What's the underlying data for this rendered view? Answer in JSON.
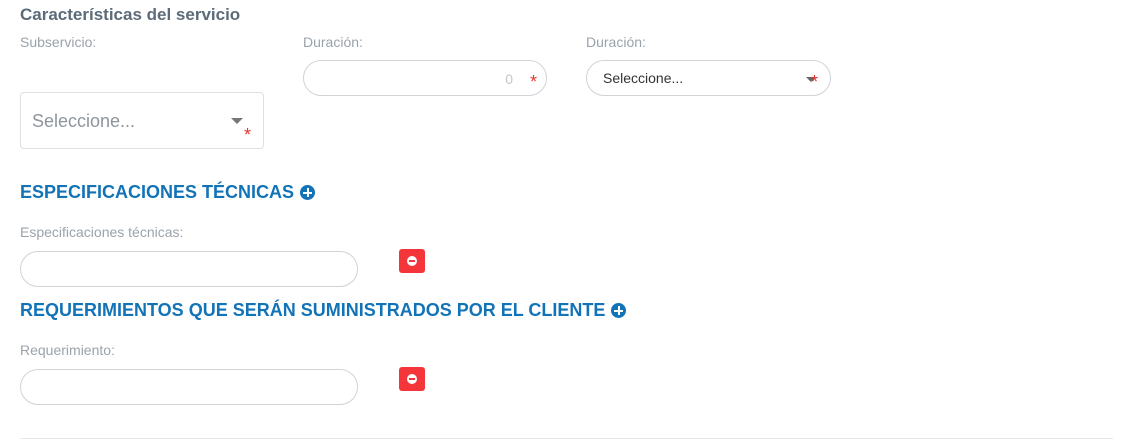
{
  "service": {
    "title": "Características del servicio",
    "subservicio_label": "Subservicio:",
    "subservicio_value": "Seleccione...",
    "duracion_label": "Duración:",
    "duracion_value": "0",
    "duracion_unit_label": "Duración:",
    "duracion_unit_value": "Seleccione...",
    "required_mark": "*"
  },
  "specs": {
    "heading": "ESPECIFICACIONES TÉCNICAS",
    "field_label": "Especificaciones técnicas:",
    "field_value": ""
  },
  "requirements": {
    "heading": "REQUERIMIENTOS QUE SERÁN SUMINISTRADOS POR EL CLIENTE",
    "field_label": "Requerimiento:",
    "field_value": ""
  },
  "icons": {
    "add": "plus-circle-icon",
    "remove": "minus-circle-icon",
    "dropdown": "caret-down-icon",
    "required": "asterisk-icon"
  },
  "colors": {
    "accent": "#1273b7",
    "danger": "#f4353a",
    "required": "#e8372c",
    "title": "#5d6b79",
    "label": "#9aa3ab"
  }
}
